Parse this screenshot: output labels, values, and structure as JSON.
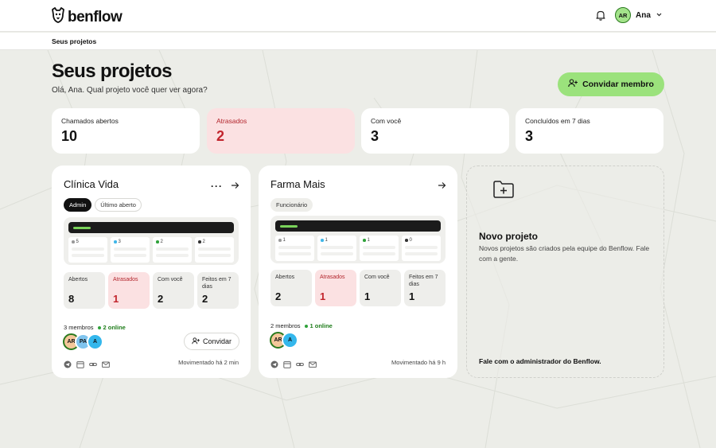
{
  "brand": {
    "name": "benflow"
  },
  "header": {
    "user_initials": "AR",
    "user_name": "Ana"
  },
  "breadcrumb": "Seus projetos",
  "page": {
    "title": "Seus projetos",
    "subtitle": "Olá, Ana. Qual projeto você quer ver agora?",
    "invite_button": "Convidar membro"
  },
  "stats": [
    {
      "label": "Chamados abertos",
      "value": "10"
    },
    {
      "label": "Atrasados",
      "value": "2"
    },
    {
      "label": "Com você",
      "value": "3"
    },
    {
      "label": "Concluídos em 7 dias",
      "value": "3"
    }
  ],
  "projects": [
    {
      "name": "Clínica Vida",
      "badges": [
        "Admin",
        "Último aberto"
      ],
      "preview_counts": [
        "5",
        "3",
        "2",
        "2"
      ],
      "minis": [
        {
          "label": "Abertos",
          "value": "8"
        },
        {
          "label": "Atrasados",
          "value": "1"
        },
        {
          "label": "Com você",
          "value": "2"
        },
        {
          "label": "Feitos em 7 dias",
          "value": "2"
        }
      ],
      "members": "3 membros",
      "online": "2 online",
      "avatars": [
        "AR",
        "PA",
        "A"
      ],
      "invite": "Convidar",
      "moved": "Movimentado há 2 min"
    },
    {
      "name": "Farma Mais",
      "badges": [
        "Funcionário"
      ],
      "preview_counts": [
        "1",
        "1",
        "1",
        "0"
      ],
      "minis": [
        {
          "label": "Abertos",
          "value": "2"
        },
        {
          "label": "Atrasados",
          "value": "1"
        },
        {
          "label": "Com você",
          "value": "1"
        },
        {
          "label": "Feitos em 7 dias",
          "value": "1"
        }
      ],
      "members": "2 membros",
      "online": "1 online",
      "avatars": [
        "AR",
        "A"
      ],
      "moved": "Movimentado há 9 h"
    }
  ],
  "new_project": {
    "title": "Novo projeto",
    "description": "Novos projetos são criados pela equipe do Benflow. Fale com a gente.",
    "footer": "Fale com o administrador do Benflow."
  },
  "colors": {
    "accent": "#9be27c",
    "alert_bg": "#fbe1e2",
    "alert_text": "#c2252d",
    "online": "#2fa23a",
    "background": "#ecede8"
  }
}
